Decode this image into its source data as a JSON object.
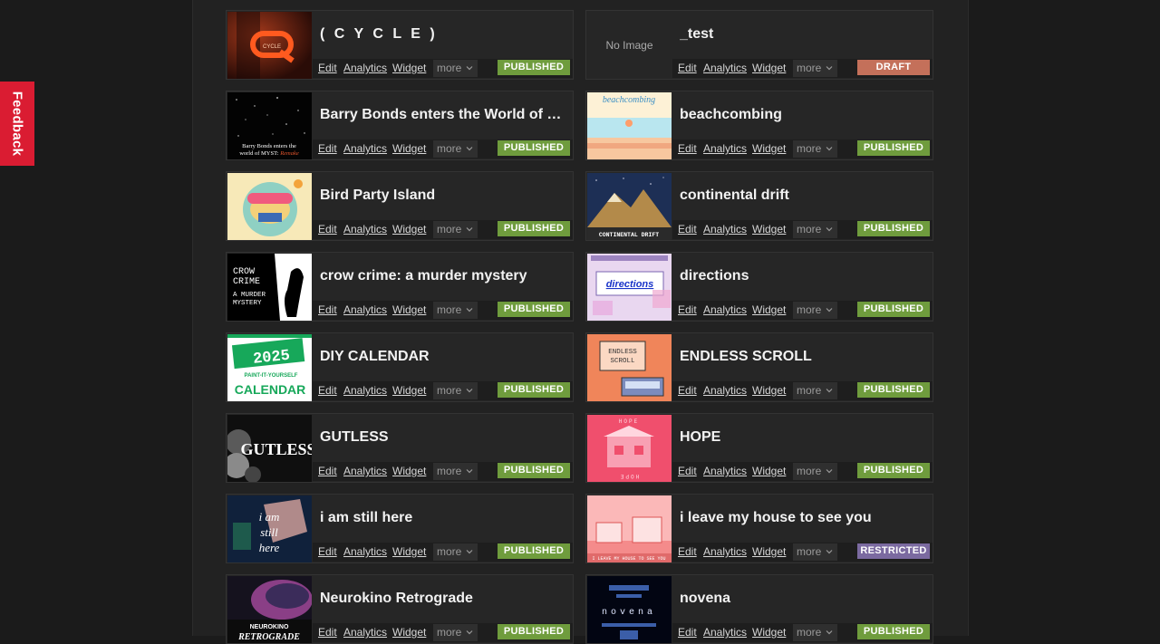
{
  "feedback_label": "Feedback",
  "actions": {
    "edit": "Edit",
    "analytics": "Analytics",
    "widget": "Widget",
    "more": "more"
  },
  "status_colors": {
    "PUBLISHED": "#6f9c3d",
    "DRAFT": "#c4705a",
    "RESTRICTED": "#7b6aa0"
  },
  "no_image_label": "No Image",
  "games": [
    {
      "title": "( C Y C L E )",
      "status": "PUBLISHED",
      "thumb": "cycle",
      "thumb_text": "CYCLE"
    },
    {
      "title": "_test",
      "status": "DRAFT",
      "thumb": "none"
    },
    {
      "title": "Barry Bonds enters the World of MYST: Remake",
      "status": "PUBLISHED",
      "thumb": "barry",
      "thumb_text": "Barry Bonds enters the world of MYST: Remake"
    },
    {
      "title": "beachcombing",
      "status": "PUBLISHED",
      "thumb": "beach",
      "thumb_text": "beachcombing"
    },
    {
      "title": "Bird Party Island",
      "status": "PUBLISHED",
      "thumb": "bird"
    },
    {
      "title": "continental drift",
      "status": "PUBLISHED",
      "thumb": "drift",
      "thumb_text": "CONTINENTAL DRIFT"
    },
    {
      "title": "crow crime: a murder mystery",
      "status": "PUBLISHED",
      "thumb": "crow",
      "thumb_text": "CROW CRIME A MURDER MYSTERY"
    },
    {
      "title": "directions",
      "status": "PUBLISHED",
      "thumb": "directions",
      "thumb_text": "directions"
    },
    {
      "title": "DIY CALENDAR",
      "status": "PUBLISHED",
      "thumb": "calendar",
      "thumb_text": "2025 PAINT-IT-YOURSELF CALENDAR"
    },
    {
      "title": "ENDLESS SCROLL",
      "status": "PUBLISHED",
      "thumb": "scroll",
      "thumb_text": "ENDLESS SCROLL"
    },
    {
      "title": "GUTLESS",
      "status": "PUBLISHED",
      "thumb": "gutless",
      "thumb_text": "GUTLESS"
    },
    {
      "title": "HOPE",
      "status": "PUBLISHED",
      "thumb": "hope",
      "thumb_text": "HOPE"
    },
    {
      "title": "i am still here",
      "status": "PUBLISHED",
      "thumb": "still",
      "thumb_text": "i am still here"
    },
    {
      "title": "i leave my house to see you",
      "status": "RESTRICTED",
      "thumb": "house",
      "thumb_text": "I LEAVE MY HOUSE TO SEE YOU"
    },
    {
      "title": "Neurokino Retrograde",
      "status": "PUBLISHED",
      "thumb": "neuro",
      "thumb_text": "NEUROKINO RETROGRADE"
    },
    {
      "title": "novena",
      "status": "PUBLISHED",
      "thumb": "novena",
      "thumb_text": "novena"
    }
  ]
}
